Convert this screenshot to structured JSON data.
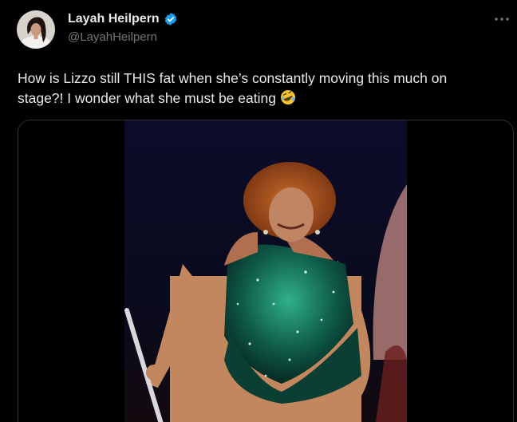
{
  "tweet": {
    "author": {
      "display_name": "Layah Heilpern",
      "handle": "@LayahHeilpern",
      "verified": true,
      "verified_color": "#1d9bf0"
    },
    "more_icon": "more-horizontal-icon",
    "text_line1": "How is Lizzo still THIS fat when she’s constantly moving this much on",
    "text_line2": "stage?! I wonder what she must be eating",
    "emoji": "rolling-on-the-floor-laughing-emoji",
    "media": {
      "type": "video-still",
      "description_icon": "video-thumbnail"
    }
  },
  "colors": {
    "background": "#000000",
    "text": "#e7e9ea",
    "secondary_text": "#71767b",
    "border": "#2f3336",
    "accent": "#1d9bf0"
  }
}
